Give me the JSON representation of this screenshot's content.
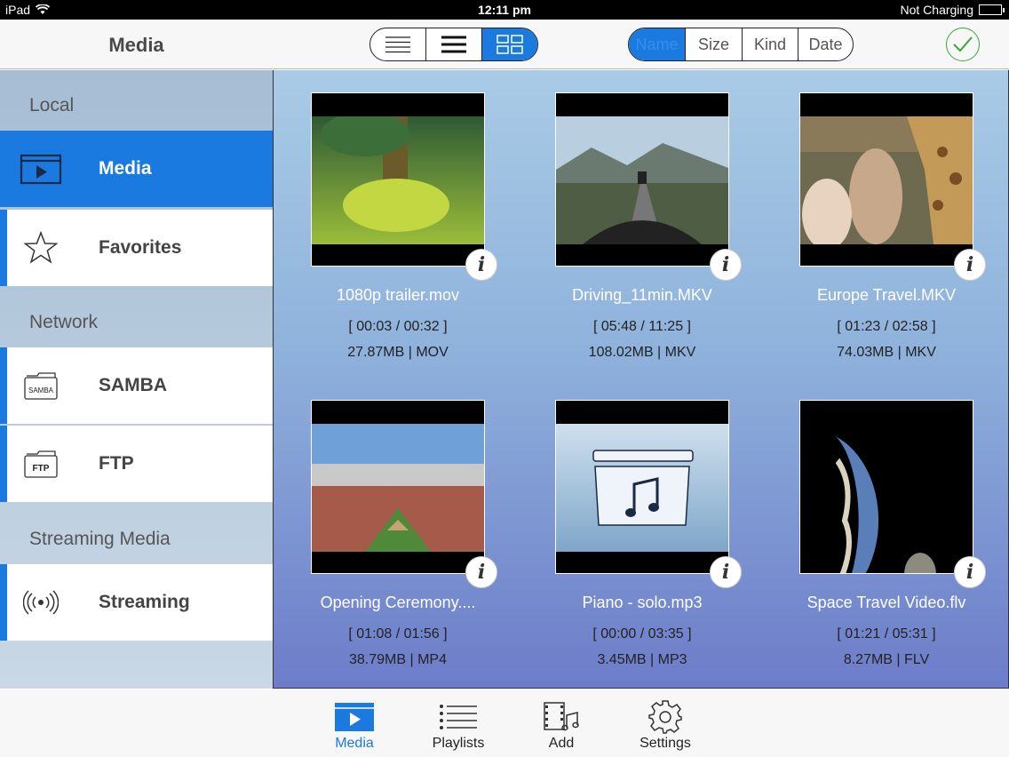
{
  "status": {
    "device": "iPad",
    "time": "12:11 pm",
    "battery_text": "Not Charging"
  },
  "nav": {
    "title": "Media",
    "sort_options": [
      "Name",
      "Size",
      "Kind",
      "Date"
    ],
    "sort_selected": "Name"
  },
  "sidebar": {
    "sections": [
      {
        "title": "Local",
        "items": [
          {
            "label": "Media",
            "icon": "media-play-icon",
            "active": true
          },
          {
            "label": "Favorites",
            "icon": "star-icon"
          }
        ]
      },
      {
        "title": "Network",
        "items": [
          {
            "label": "SAMBA",
            "icon": "samba-folder-icon",
            "badge": "SAMBA"
          },
          {
            "label": "FTP",
            "icon": "ftp-folder-icon",
            "badge": "FTP"
          }
        ]
      },
      {
        "title": "Streaming Media",
        "items": [
          {
            "label": "Streaming",
            "icon": "broadcast-icon"
          }
        ]
      }
    ]
  },
  "media": [
    {
      "name": "1080p trailer.mov",
      "time": "[ 00:03  / 00:32 ]",
      "size": "27.87MB | MOV"
    },
    {
      "name": "Driving_11min.MKV",
      "time": "[ 05:48  / 11:25 ]",
      "size": "108.02MB | MKV"
    },
    {
      "name": "Europe Travel.MKV",
      "time": "[ 01:23  / 02:58 ]",
      "size": "74.03MB | MKV"
    },
    {
      "name": "Opening Ceremony....",
      "time": "[ 01:08  / 01:56 ]",
      "size": "38.79MB | MP4"
    },
    {
      "name": "Piano - solo.mp3",
      "time": "[ 00:00 / 03:35 ]",
      "size": "3.45MB | MP3"
    },
    {
      "name": "Space Travel Video.flv",
      "time": "[ 01:21  / 05:31 ]",
      "size": "8.27MB | FLV"
    }
  ],
  "info_glyph": "i",
  "tabs": [
    {
      "label": "Media",
      "icon": "media-play-icon",
      "active": true
    },
    {
      "label": "Playlists",
      "icon": "list-icon"
    },
    {
      "label": "Add",
      "icon": "film-music-icon"
    },
    {
      "label": "Settings",
      "icon": "gear-icon"
    }
  ],
  "colors": {
    "accent": "#1a7ae0",
    "check": "#3aa63a"
  }
}
